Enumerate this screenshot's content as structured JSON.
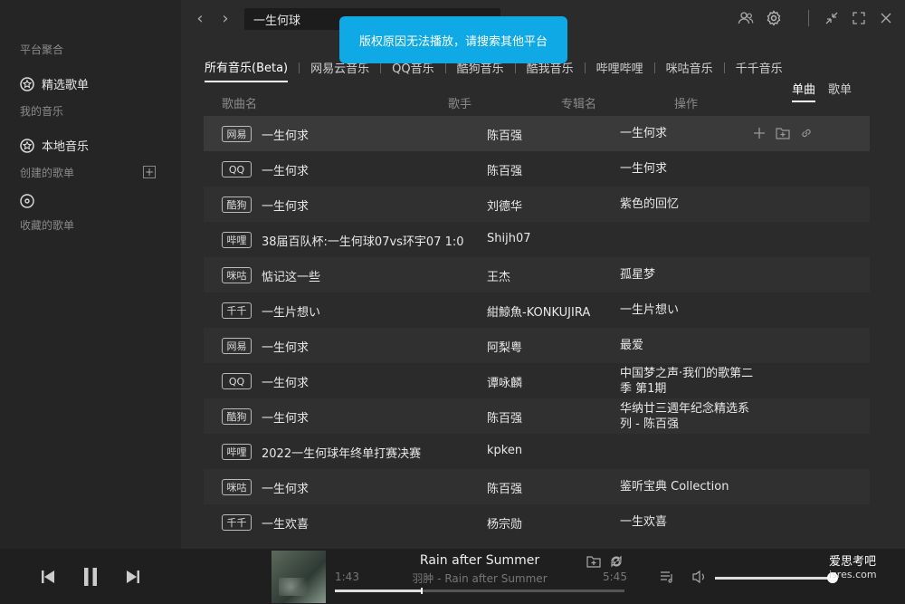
{
  "sidebar": {
    "section_platform": "平台聚合",
    "item_featured": "精选歌单",
    "section_my_music": "我的音乐",
    "item_local": "本地音乐",
    "section_created": "创建的歌单",
    "section_favorites": "收藏的歌单"
  },
  "topbar": {
    "search_value": "一生何球"
  },
  "toast": "版权原因无法播放，请搜索其他平台",
  "platform_tabs": [
    "所有音乐(Beta)",
    "网易云音乐",
    "QQ音乐",
    "酷狗音乐",
    "酷我音乐",
    "哔哩哔哩",
    "咪咕音乐",
    "千千音乐"
  ],
  "view_tabs": [
    "单曲",
    "歌单"
  ],
  "columns": {
    "title": "歌曲名",
    "artist": "歌手",
    "album": "专辑名",
    "ops": "操作"
  },
  "rows": [
    {
      "source": "网易",
      "title": "一生何求",
      "artist": "陈百强",
      "album": "一生何求"
    },
    {
      "source": "QQ",
      "title": "一生何求",
      "artist": "陈百强",
      "album": "一生何求"
    },
    {
      "source": "酷狗",
      "title": "一生何求",
      "artist": "刘德华",
      "album": "紫色的回忆"
    },
    {
      "source": "哔哩",
      "title": "38届百队杯:一生何球07vs环宇07 1:0",
      "artist": "Shijh07",
      "album": ""
    },
    {
      "source": "咪咕",
      "title": "惦记这一些",
      "artist": "王杰",
      "album": "孤星梦"
    },
    {
      "source": "千千",
      "title": "一生片想い",
      "artist": "紺鯨魚-KONKUJIRA",
      "album": "一生片想い"
    },
    {
      "source": "网易",
      "title": "一生何求",
      "artist": "阿梨粤",
      "album": "最爱"
    },
    {
      "source": "QQ",
      "title": "一生何求",
      "artist": "谭咏麟",
      "album": "中国梦之声·我们的歌第二季 第1期"
    },
    {
      "source": "酷狗",
      "title": "一生何求",
      "artist": "陈百强",
      "album": "华纳廿三週年纪念精选系列 - 陈百强"
    },
    {
      "source": "哔哩",
      "title": "2022一生何球年终单打赛决赛",
      "artist": "kpken",
      "album": ""
    },
    {
      "source": "咪咕",
      "title": "一生何求",
      "artist": "陈百强",
      "album": "鉴听宝典 Collection"
    },
    {
      "source": "千千",
      "title": "一生欢喜",
      "artist": "杨宗勋",
      "album": "一生欢喜"
    }
  ],
  "player": {
    "title": "Rain after Summer",
    "subtitle": "羽肿 - Rain after Summer",
    "current_time": "1:43",
    "total_time": "5:45",
    "progress": 0.3,
    "volume": 1.0
  },
  "watermark": {
    "line1": "爱思考吧",
    "line2": "isres.com"
  },
  "colors": {
    "toast": "#0fa9e6",
    "background": "#2b2b2b",
    "sidebar": "#252525",
    "player": "#1f1f1f"
  }
}
